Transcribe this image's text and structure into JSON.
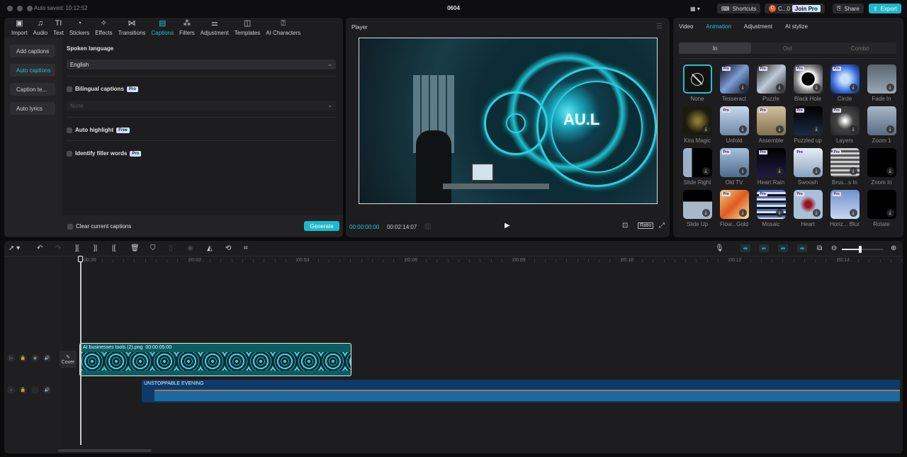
{
  "app": {
    "auto_saved": "Auto saved: 10:12:52",
    "title": "0604",
    "layout_icon": "layout-icon",
    "shortcuts_label": "Shortcuts",
    "account_label": "C...0",
    "account_initial": "C",
    "join_pro_label": "Join Pro",
    "share_label": "Share",
    "export_label": "Export",
    "accent_color": "#1fc0d0"
  },
  "toolbar": {
    "items": [
      {
        "label": "Import",
        "icon": "import-icon"
      },
      {
        "label": "Audio",
        "icon": "audio-icon"
      },
      {
        "label": "Text",
        "icon": "text-icon"
      },
      {
        "label": "Stickers",
        "icon": "stickers-icon"
      },
      {
        "label": "Effects",
        "icon": "effects-icon"
      },
      {
        "label": "Transitions",
        "icon": "transitions-icon"
      },
      {
        "label": "Captions",
        "icon": "captions-icon",
        "active": true
      },
      {
        "label": "Filters",
        "icon": "filters-icon"
      },
      {
        "label": "Adjustment",
        "icon": "adjustment-icon"
      },
      {
        "label": "Templates",
        "icon": "templates-icon"
      },
      {
        "label": "AI Characters",
        "icon": "ai-characters-icon"
      }
    ]
  },
  "captions": {
    "subnav": [
      "Add captions",
      "Auto captions",
      "Caption te...",
      "Auto lyrics"
    ],
    "active_subnav": "Auto captions",
    "spoken_language_label": "Spoken language",
    "spoken_language_value": "English",
    "bilingual_label": "Bilingual captions",
    "bilingual_badge": "Pro",
    "bilingual_value": "None",
    "auto_highlight_label": "Auto highlight",
    "auto_highlight_badge": "Free",
    "filler_label": "Identify filler words",
    "filler_badge": "Pro",
    "clear_label": "Clear current captions",
    "generate_label": "Generate"
  },
  "player": {
    "title": "Player",
    "current_time": "00:00:00:00",
    "total_time": "00:02:14:07",
    "ratio_label": "Ratio",
    "preview_text": "AU.L"
  },
  "inspector": {
    "tabs": [
      "Video",
      "Animation",
      "Adjustment",
      "AI stylize"
    ],
    "active_tab": "Animation",
    "segments": [
      "In",
      "Out",
      "Combo"
    ],
    "active_segment": "In",
    "animations": [
      {
        "name": "None",
        "pro": false
      },
      {
        "name": "Tesseract",
        "pro": true
      },
      {
        "name": "Puzzle",
        "pro": true
      },
      {
        "name": "Black Hole",
        "pro": true
      },
      {
        "name": "Circle",
        "pro": true
      },
      {
        "name": "Fade In",
        "pro": false
      },
      {
        "name": "Kira Magic",
        "pro": false
      },
      {
        "name": "Unfold",
        "pro": true
      },
      {
        "name": "Assemble",
        "pro": true
      },
      {
        "name": "Puzzled up",
        "pro": true
      },
      {
        "name": "Layers",
        "pro": true
      },
      {
        "name": "Zoom 1",
        "pro": false
      },
      {
        "name": "Slide Right",
        "pro": false
      },
      {
        "name": "Old TV",
        "pro": true
      },
      {
        "name": "Heart Rain",
        "pro": true
      },
      {
        "name": "Swoosh",
        "pro": true
      },
      {
        "name": "Brus...s In",
        "pro": true
      },
      {
        "name": "Zoom In",
        "pro": false
      },
      {
        "name": "Slide Up",
        "pro": false
      },
      {
        "name": "Flow...Gold",
        "pro": true
      },
      {
        "name": "Mosaic",
        "pro": true
      },
      {
        "name": "Heart",
        "pro": true
      },
      {
        "name": "Horiz... Blur",
        "pro": true
      },
      {
        "name": "Rotate",
        "pro": false
      }
    ]
  },
  "timeline": {
    "ruler": [
      "00:00",
      "00:02",
      "00:04",
      "00:06",
      "00:08",
      "00:10",
      "00:12",
      "00:14"
    ],
    "cover_label": "Cover",
    "video_clip": {
      "name": "AI businesses tools (2).png",
      "duration": "00:00:05:00"
    },
    "audio_clip": {
      "name": "UNSTOPPABLE EVENING"
    },
    "zoom_level": 0.45
  }
}
